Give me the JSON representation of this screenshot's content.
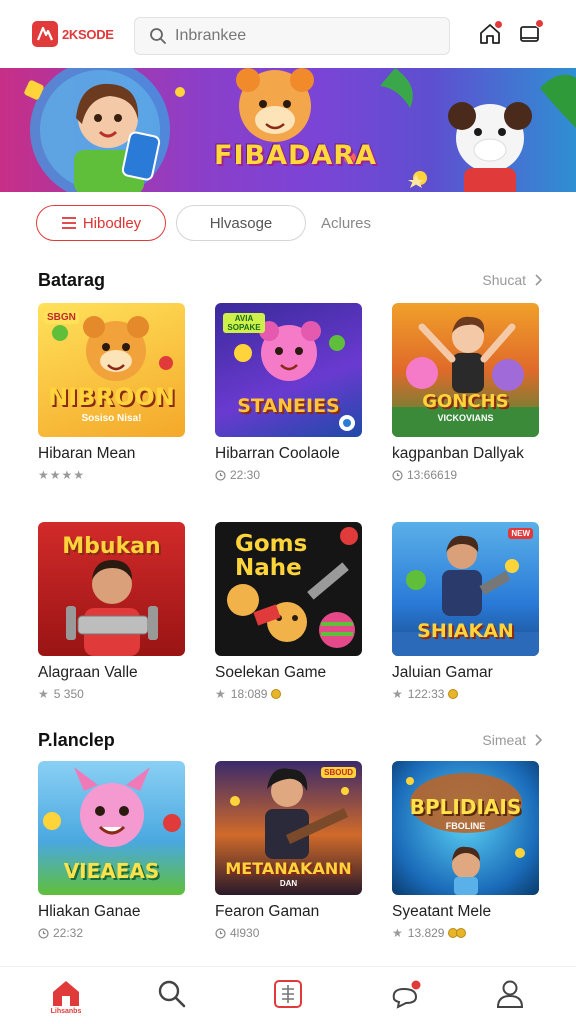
{
  "header": {
    "logo_text": "2KSODE",
    "search_placeholder": "Inbrankee",
    "icons": [
      "home-notification-icon",
      "message-notification-icon"
    ],
    "accent_color": "#e03a3a"
  },
  "banner": {
    "title": "FIBADARA"
  },
  "chips": [
    {
      "label": "Hibodley",
      "active": true
    },
    {
      "label": "Hlvasoge",
      "active": false
    },
    {
      "label": "Aclures",
      "active": false
    }
  ],
  "sections": [
    {
      "title": "Batarag",
      "more": "Shucat",
      "cards": [
        {
          "thumb_title": "NIBROON",
          "thumb_caption": "Sosiso Nisa!",
          "thumb_tag": "SBGN",
          "title": "Hibaran Mean",
          "meta": "★★★★",
          "meta_type": "stars"
        },
        {
          "thumb_title": "STANEIES",
          "thumb_caption": "",
          "thumb_tag": "AVIA SOPAKE",
          "title": "Hibarran Coolaole",
          "meta": "22:30",
          "meta_type": "time"
        },
        {
          "thumb_title": "GONCHS",
          "thumb_caption": "VICKOVIANS",
          "thumb_tag": "",
          "title": "kagpanban Dallyak",
          "meta": "13:66619",
          "meta_type": "time"
        }
      ]
    },
    {
      "title": "",
      "more": "",
      "cards": [
        {
          "thumb_title": "Mbukan",
          "thumb_caption": "",
          "thumb_tag": "",
          "title": "Alagraan Valle",
          "meta": "5 350",
          "meta_type": "star1"
        },
        {
          "thumb_title": "Goms Nahe",
          "thumb_caption": "",
          "thumb_tag": "",
          "title": "Soelekan Game",
          "meta": "18:089",
          "meta_type": "star1coin"
        },
        {
          "thumb_title": "SHIAKAN",
          "thumb_caption": "",
          "thumb_tag": "NEW",
          "title": "Jaluian Gamar",
          "meta": "122:33",
          "meta_type": "star1coin"
        }
      ]
    },
    {
      "title": "P.lanclep",
      "more": "Simeat",
      "cards": [
        {
          "thumb_title": "VIEAEAS",
          "thumb_caption": "",
          "thumb_tag": "",
          "title": "Hliakan Ganae",
          "meta": "22:32",
          "meta_type": "time"
        },
        {
          "thumb_title": "METANAKANN",
          "thumb_caption": "DAN",
          "thumb_tag": "SBOUD",
          "title": "Fearon Gaman",
          "meta": "4l930",
          "meta_type": "time"
        },
        {
          "thumb_title": "BPLIDIAIS",
          "thumb_caption": "FBOLINE",
          "thumb_tag": "",
          "title": "Syeatant Mele",
          "meta": "13.829",
          "meta_type": "star1coin2"
        }
      ]
    }
  ],
  "bottom_nav": {
    "items": [
      {
        "name": "home",
        "label": "Lihsanbs",
        "active": true
      },
      {
        "name": "search",
        "label": "",
        "active": false
      },
      {
        "name": "library",
        "label": "",
        "active": false
      },
      {
        "name": "chat",
        "label": "",
        "active": false
      },
      {
        "name": "profile",
        "label": "",
        "active": false
      }
    ]
  }
}
